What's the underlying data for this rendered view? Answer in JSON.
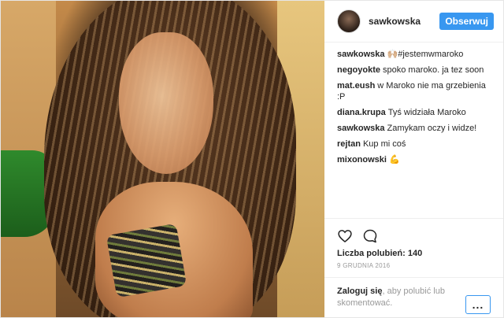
{
  "post": {
    "username": "sawkowska",
    "follow_label": "Obserwuj",
    "accent_color": "#3897f0"
  },
  "comments": [
    {
      "author": "sawkowska",
      "text": "🙌🏼#jestemwmaroko"
    },
    {
      "author": "negoyokte",
      "text": "spoko maroko. ja tez soon"
    },
    {
      "author": "mat.eush",
      "text": "w Maroko nie ma grzebienia :P"
    },
    {
      "author": "diana.krupa",
      "text": "Tyś widziała Maroko"
    },
    {
      "author": "sawkowska",
      "text": "Zamykam oczy i widze!"
    },
    {
      "author": "rejtan",
      "text": "Kup mi coś"
    },
    {
      "author": "mixonowski",
      "text": "💪"
    }
  ],
  "actions": {
    "like_icon": "heart-icon",
    "comment_icon": "comment-icon"
  },
  "likes": {
    "label": "Liczba polubień: 140"
  },
  "date": "9 grudnia 2016",
  "login": {
    "link": "Zaloguj się",
    "suffix": ", aby polubić lub skomentować."
  },
  "more": {
    "icon": "more-options-icon",
    "label": "..."
  }
}
